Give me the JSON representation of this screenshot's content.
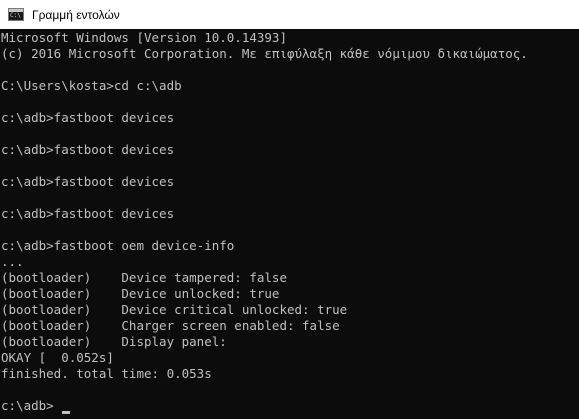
{
  "window": {
    "title": "Γραμμή εντολών",
    "icon": "command-prompt-icon"
  },
  "console": {
    "lines": [
      "Microsoft Windows [Version 10.0.14393]",
      "(c) 2016 Microsoft Corporation. Με επιφύλαξη κάθε νόμιμου δικαιώματος.",
      "",
      "C:\\Users\\kosta>cd c:\\adb",
      "",
      "c:\\adb>fastboot devices",
      "",
      "c:\\adb>fastboot devices",
      "",
      "c:\\adb>fastboot devices",
      "",
      "c:\\adb>fastboot devices",
      "",
      "c:\\adb>fastboot oem device-info",
      "...",
      "(bootloader)    Device tampered: false",
      "(bootloader)    Device unlocked: true",
      "(bootloader)    Device critical unlocked: true",
      "(bootloader)    Charger screen enabled: false",
      "(bootloader)    Display panel:",
      "OKAY [  0.052s]",
      "finished. total time: 0.053s",
      "",
      "c:\\adb>"
    ]
  }
}
